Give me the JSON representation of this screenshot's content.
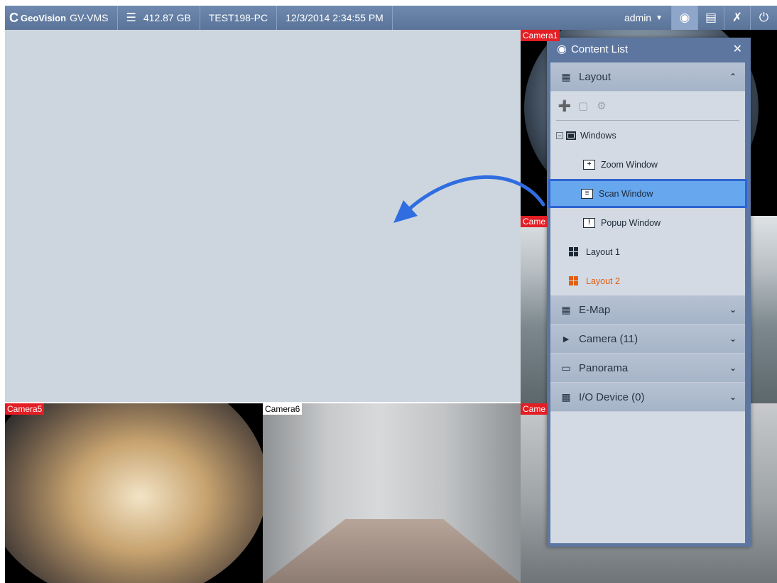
{
  "topbar": {
    "brand": "GeoVision",
    "product": "GV-VMS",
    "storage": "412.87 GB",
    "pc_name": "TEST198-PC",
    "datetime": "12/3/2014 2:34:55 PM",
    "user": "admin",
    "icons": [
      "database-icon",
      "eye-icon",
      "film-icon",
      "tools-icon",
      "power-icon"
    ]
  },
  "cameras": {
    "top_right": "Camera1",
    "middle_right": "Came",
    "cam5": "Camera5",
    "cam6": "Camera6",
    "bottom_right": "Came"
  },
  "content_list": {
    "title": "Content List",
    "layout_section": {
      "label": "Layout",
      "tree": {
        "windows": "Windows",
        "zoom": "Zoom Window",
        "scan": "Scan Window",
        "popup": "Popup Window",
        "layout1": "Layout 1",
        "layout2": "Layout 2"
      }
    },
    "sections": {
      "emap": "E-Map",
      "camera": "Camera (11)",
      "panorama": "Panorama",
      "io": "I/O Device (0)"
    }
  },
  "colors": {
    "topbar": "#627da4",
    "selection": "#66a7ee",
    "selection_border": "#2f64d2",
    "active_layout": "#e35d10",
    "camera_label_red": "#e31e24",
    "arrow": "#2f6de0"
  }
}
